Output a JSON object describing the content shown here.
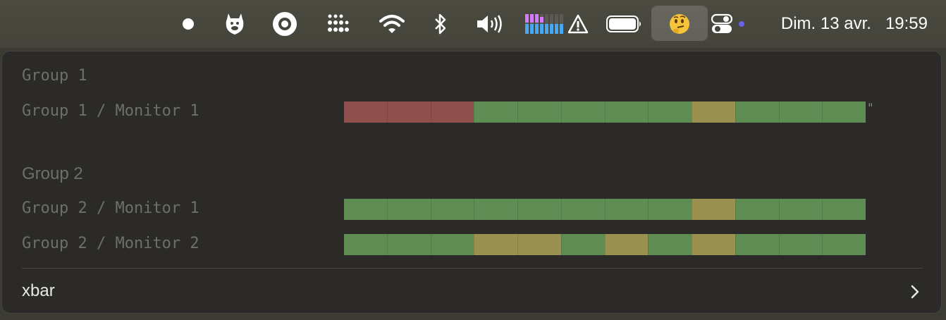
{
  "menubar": {
    "icons": [
      {
        "name": "dot-icon"
      },
      {
        "name": "llama-icon"
      },
      {
        "name": "target-icon"
      },
      {
        "name": "grid-dots-icon"
      },
      {
        "name": "wifi-icon"
      },
      {
        "name": "bluetooth-icon"
      },
      {
        "name": "volume-icon"
      },
      {
        "name": "cpu-meter-icon"
      },
      {
        "name": "warning-icon"
      },
      {
        "name": "battery-icon"
      },
      {
        "name": "thinking-face-icon"
      },
      {
        "name": "control-center-icon"
      }
    ],
    "date": "Dim. 13 avr.",
    "time": "19:59"
  },
  "menu": {
    "groups": [
      {
        "title": "Group 1",
        "monitors": [
          {
            "label": "Group 1 / Monitor 1",
            "segments": [
              "down",
              "down",
              "down",
              "up",
              "up",
              "up",
              "up",
              "up",
              "warn",
              "up",
              "up",
              "up"
            ],
            "suffix": "\""
          }
        ]
      },
      {
        "title": "Group 2",
        "monitors": [
          {
            "label": "Group 2 / Monitor 1",
            "segments": [
              "up",
              "up",
              "up",
              "up",
              "up",
              "up",
              "up",
              "up",
              "warn",
              "up",
              "up",
              "up"
            ]
          },
          {
            "label": "Group 2 / Monitor 2",
            "segments": [
              "up",
              "up",
              "up",
              "warn",
              "warn",
              "up",
              "warn",
              "up",
              "warn",
              "up",
              "up",
              "up"
            ]
          }
        ]
      }
    ],
    "footer_label": "xbar",
    "colors": {
      "up": "#5e8c52",
      "down": "#8f4f4d",
      "warn": "#9a9150"
    }
  }
}
